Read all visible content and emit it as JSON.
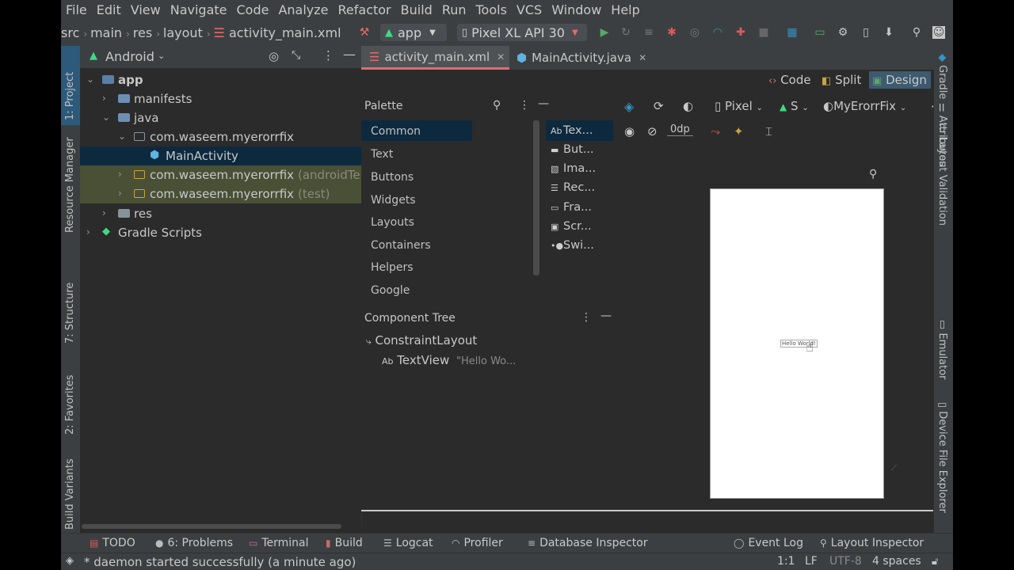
{
  "menu": [
    "File",
    "Edit",
    "View",
    "Navigate",
    "Code",
    "Analyze",
    "Refactor",
    "Build",
    "Run",
    "Tools",
    "VCS",
    "Window",
    "Help"
  ],
  "breadcrumb": {
    "items": [
      "src",
      "main",
      "res",
      "layout"
    ],
    "file": "activity_main.xml"
  },
  "run_config": "app",
  "device": "Pixel XL API 30",
  "left_tabs": {
    "project": "1: Project",
    "resource_manager": "Resource Manager",
    "structure": "7: Structure",
    "favorites": "2: Favorites",
    "build_variants": "Build Variants"
  },
  "project": {
    "view_mode": "Android",
    "tree": {
      "app": "app",
      "manifests": "manifests",
      "java": "java",
      "pkg_main": "com.waseem.myerorrfix",
      "main_activity": "MainActivity",
      "pkg_android_test": "com.waseem.myerorrfix",
      "pkg_android_test_suffix": "(androidTe",
      "pkg_test": "com.waseem.myerorrfix",
      "pkg_test_suffix": "(test)",
      "res": "res",
      "gradle": "Gradle Scripts"
    }
  },
  "editor_tabs": [
    {
      "label": "activity_main.xml",
      "active": true
    },
    {
      "label": "MainActivity.java",
      "active": false
    }
  ],
  "view_modes": {
    "code": "Code",
    "split": "Split",
    "design": "Design"
  },
  "palette": {
    "title": "Palette",
    "categories": [
      "Common",
      "Text",
      "Buttons",
      "Widgets",
      "Layouts",
      "Containers",
      "Helpers",
      "Google"
    ],
    "items": [
      {
        "icon": "Ab",
        "label": "Tex..."
      },
      {
        "icon": "▬",
        "label": "But..."
      },
      {
        "icon": "▧",
        "label": "Ima..."
      },
      {
        "icon": "☰",
        "label": "Rec..."
      },
      {
        "icon": "▭",
        "label": "Fra..."
      },
      {
        "icon": "▣",
        "label": "Scr..."
      },
      {
        "icon": "•●",
        "label": "Swi..."
      }
    ]
  },
  "design_toolbar": {
    "device": "Pixel",
    "api": "S",
    "theme": "MyErorrFix",
    "margin": "0dp"
  },
  "component_tree": {
    "title": "Component Tree",
    "root": "ConstraintLayout",
    "child": "TextView",
    "child_text": "\"Hello Wo..."
  },
  "canvas": {
    "text": "Hello World!"
  },
  "right_tabs": {
    "gradle": "Gradle",
    "attributes": "Attributes",
    "layout_validation": "Layout Validation",
    "emulator": "Emulator",
    "device_file_explorer": "Device File Explorer"
  },
  "bottom_tools": {
    "todo": "TODO",
    "problems": "6: Problems",
    "terminal": "Terminal",
    "build": "Build",
    "logcat": "Logcat",
    "profiler": "Profiler",
    "database": "Database Inspector",
    "event_log": "Event Log",
    "layout_inspector": "Layout Inspector"
  },
  "status": {
    "message": "* daemon started successfully (a minute ago)",
    "position": "1:1",
    "line_sep": "LF",
    "encoding": "UTF-8",
    "indent": "4 spaces"
  },
  "colors": {
    "accent": "#3592c4",
    "selection": "#0d293e",
    "test_bg": "#4a5036",
    "folder": "#87939a",
    "android_green": "#3ddc84"
  }
}
